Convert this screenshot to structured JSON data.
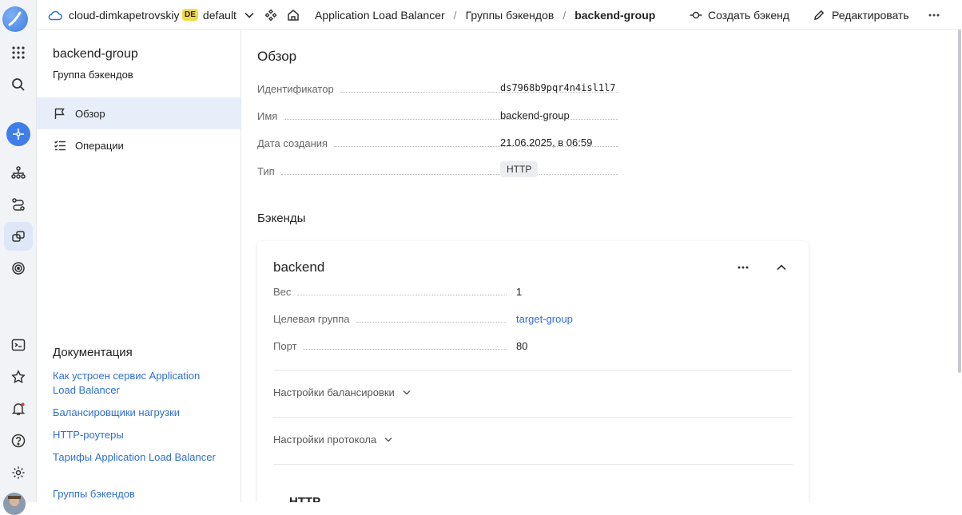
{
  "topbar": {
    "cloud_name": "cloud-dimkapetrovskiy",
    "folder_badge": "DE",
    "folder_name": "default",
    "breadcrumbs": [
      "Application Load Balancer",
      "Группы бэкендов",
      "backend-group"
    ],
    "create_backend_label": "Создать бэкенд",
    "edit_label": "Редактировать"
  },
  "sidebar": {
    "title": "backend-group",
    "subtitle": "Группа бэкендов",
    "items": [
      {
        "label": "Обзор",
        "icon": "flag-icon",
        "active": true
      },
      {
        "label": "Операции",
        "icon": "list-check-icon",
        "active": false
      }
    ],
    "docs_title": "Документация",
    "docs_links": [
      "Как устроен сервис Application Load Balancer",
      "Балансировщики нагрузки",
      "HTTP-роутеры",
      "Тарифы Application Load Balancer",
      "Группы бэкендов"
    ]
  },
  "overview": {
    "heading": "Обзор",
    "fields": [
      {
        "key": "Идентификатор",
        "value": "ds7968b9pqr4n4isl1l7"
      },
      {
        "key": "Имя",
        "value": "backend-group"
      },
      {
        "key": "Дата создания",
        "value": "21.06.2025, в 06:59"
      },
      {
        "key": "Тип",
        "value": "HTTP"
      }
    ]
  },
  "backends": {
    "heading": "Бэкенды",
    "card": {
      "title": "backend",
      "fields": [
        {
          "key": "Вес",
          "value": "1"
        },
        {
          "key": "Целевая группа",
          "value": "target-group"
        },
        {
          "key": "Порт",
          "value": "80"
        }
      ],
      "sections": [
        "Настройки балансировки",
        "Настройки протокола"
      ],
      "cut_section": "HTTP"
    }
  },
  "colors": {
    "accent": "#2f6fd1",
    "active_bg": "#e8eef9",
    "rail_bg": "#f1f3f6",
    "badge_yellow": "#f2da44"
  }
}
